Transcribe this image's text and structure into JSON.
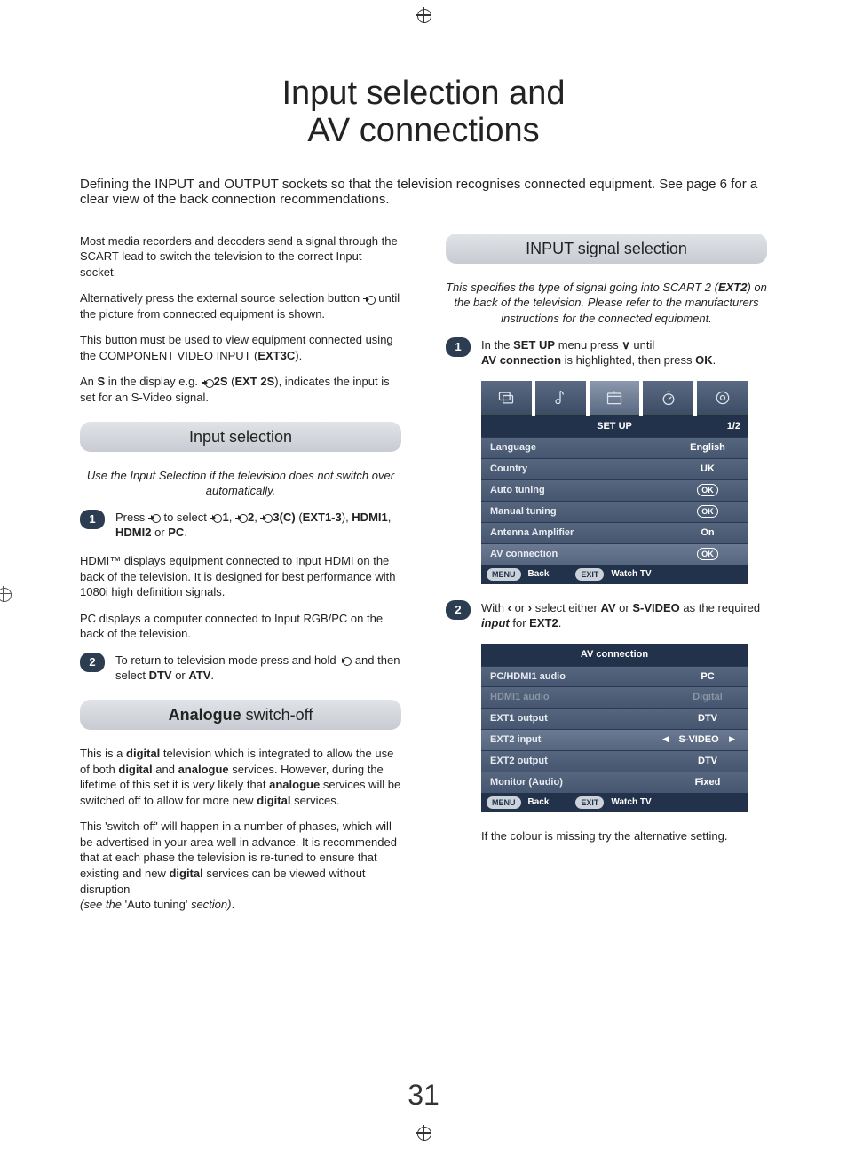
{
  "title_line1": "Input selection and",
  "title_line2": "AV connections",
  "intro": "Defining the INPUT and OUTPUT sockets so that the television recognises connected equipment. See page 6 for a clear view of the back connection recommendations.",
  "left": {
    "p1": "Most media recorders and decoders send a signal through the SCART lead to switch the television to the correct Input socket.",
    "p2a": "Alternatively press the external source selection button ",
    "p2b": " until the picture from connected equipment is shown.",
    "p3a": "This button must be used to view equipment connected using the COMPONENT VIDEO INPUT (",
    "p3b": "EXT3C",
    "p3c": ").",
    "p4a": "An ",
    "p4b": "S",
    "p4c": " in the display e.g. ",
    "p4d": "2S",
    "p4e": " (",
    "p4f": "EXT 2S",
    "p4g": "), indicates the input is set for an S-Video signal.",
    "sec_input": "Input selection",
    "note_input": "Use the Input Selection if the television does not switch over automatically.",
    "s1a": "Press ",
    "s1b": " to select ",
    "s1c": "1",
    "s1d": "2",
    "s1e": "3(C)",
    "s1f": " (",
    "s1g": "EXT1-3",
    "s1h": "), ",
    "s1i": "HDMI1",
    "s1j": ", ",
    "s1k": "HDMI2",
    "s1l": " or ",
    "s1m": "PC",
    "s1n": ".",
    "s1p2": "HDMI™ displays equipment connected to Input HDMI on the back of the television. It is designed for best performance with 1080i high definition signals.",
    "s1p3": "PC displays a computer connected to Input RGB/PC on the back of the television.",
    "s2a": "To return to television mode press and hold ",
    "s2b": " and then select ",
    "s2c": "DTV",
    "s2d": " or ",
    "s2e": "ATV",
    "s2f": ".",
    "sec_analogue_b": "Analogue",
    "sec_analogue_r": " switch-off",
    "an_p1": "This is a digital television which is integrated to allow the use of both digital and analogue services. However, during the lifetime of this set it is very likely that analogue services will be switched off to allow for more new digital services.",
    "an_p2": "This 'switch-off' will happen in a number of phases, which will be advertised in your area well in advance. It is recommended that at each phase the television is re-tuned to ensure that existing and new digital services can be viewed without disruption (see the 'Auto tuning' section)."
  },
  "right": {
    "sec_signal": "INPUT signal selection",
    "note_signal": "This specifies the type of signal going into SCART 2 (EXT2) on the back of the television. Please refer to the manufacturers instructions for the connected equipment.",
    "r1a": "In the ",
    "r1b": "SET UP",
    "r1c": " menu press ",
    "r1d": " until ",
    "r1e": "AV connection",
    "r1f": " is highlighted, then press ",
    "r1g": "OK",
    "r1h": ".",
    "osd1": {
      "title": "SET UP",
      "page": "1/2",
      "rows": [
        {
          "lbl": "Language",
          "val": "English"
        },
        {
          "lbl": "Country",
          "val": "UK"
        },
        {
          "lbl": "Auto tuning",
          "val": "OK"
        },
        {
          "lbl": "Manual tuning",
          "val": "OK"
        },
        {
          "lbl": "Antenna Amplifier",
          "val": "On"
        },
        {
          "lbl": "AV connection",
          "val": "OK"
        }
      ],
      "foot_menu": "MENU",
      "foot_back": "Back",
      "foot_exit": "EXIT",
      "foot_watch": "Watch TV"
    },
    "r2a": "With ",
    "r2b": " or ",
    "r2c": " select either ",
    "r2d": "AV",
    "r2e": " or ",
    "r2f": "S-VIDEO",
    "r2g": " as the required ",
    "r2h": "input",
    "r2i": " for ",
    "r2j": "EXT2",
    "r2k": ".",
    "osd2": {
      "title": "AV connection",
      "rows": [
        {
          "lbl": "PC/HDMI1 audio",
          "val": "PC"
        },
        {
          "lbl": "HDMI1 audio",
          "val": "Digital",
          "dim": true
        },
        {
          "lbl": "EXT1 output",
          "val": "DTV"
        },
        {
          "lbl": "EXT2 input",
          "val": "S-VIDEO",
          "arrows": true
        },
        {
          "lbl": "EXT2 output",
          "val": "DTV"
        },
        {
          "lbl": "Monitor (Audio)",
          "val": "Fixed"
        }
      ],
      "foot_menu": "MENU",
      "foot_back": "Back",
      "foot_exit": "EXIT",
      "foot_watch": "Watch TV"
    },
    "tail": "If the colour is missing try the alternative setting."
  },
  "page_number": "31",
  "step1": "1",
  "step2": "2"
}
